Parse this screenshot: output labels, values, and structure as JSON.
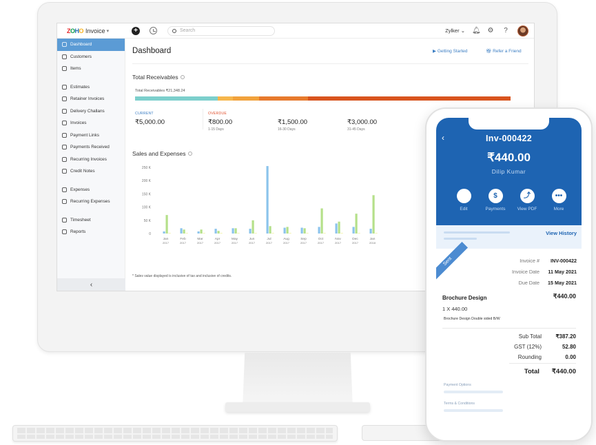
{
  "app": {
    "logo_letters": [
      "Z",
      "O",
      "H",
      "O"
    ],
    "name": "Invoice",
    "search_placeholder": "Search",
    "org": "Zylker",
    "org_chevron": "⌄"
  },
  "sidebar": {
    "items": [
      {
        "label": "Dashboard",
        "icon": "home-icon",
        "active": true
      },
      {
        "label": "Customers",
        "icon": "user-icon"
      },
      {
        "label": "Items",
        "icon": "box-icon"
      },
      {
        "label": "Estimates",
        "icon": "estimate-icon"
      },
      {
        "label": "Retainer Invoices",
        "icon": "retainer-icon"
      },
      {
        "label": "Delivery Challans",
        "icon": "truck-icon"
      },
      {
        "label": "Invoices",
        "icon": "invoice-icon"
      },
      {
        "label": "Payment Links",
        "icon": "link-icon"
      },
      {
        "label": "Payments Received",
        "icon": "payment-icon"
      },
      {
        "label": "Recurring Invoices",
        "icon": "recurring-icon"
      },
      {
        "label": "Credit Notes",
        "icon": "credit-note-icon"
      },
      {
        "label": "Expenses",
        "icon": "expense-icon"
      },
      {
        "label": "Recurring Expenses",
        "icon": "recurring-expense-icon"
      },
      {
        "label": "Timesheet",
        "icon": "timesheet-icon"
      },
      {
        "label": "Reports",
        "icon": "reports-icon"
      }
    ],
    "collapse_label": "‹"
  },
  "dashboard": {
    "title": "Dashboard",
    "getting_started": "Getting Started",
    "refer": "Refer a Friend",
    "receivables_title": "Total Receivables",
    "receivables_label": "Total Receivables ₹21,348.24",
    "receivables_bar": [
      {
        "fraction": 0.22,
        "color": "#7ccfcc"
      },
      {
        "fraction": 0.04,
        "color": "#f6b64c"
      },
      {
        "fraction": 0.07,
        "color": "#f1a23c"
      },
      {
        "fraction": 0.13,
        "color": "#e77a2d"
      },
      {
        "fraction": 0.54,
        "color": "#d8541e"
      }
    ],
    "current": {
      "label": "CURRENT",
      "value": "₹5,000.00"
    },
    "overdue_label": "OVERDUE",
    "buckets": [
      {
        "value": "₹800.00",
        "range": "1-15 Days"
      },
      {
        "value": "₹1,500.00",
        "range": "16-30 Days"
      },
      {
        "value": "₹3,000.00",
        "range": "31-45 Days"
      }
    ],
    "sales_title": "Sales and Expenses",
    "note": "* Sales value displayed is inclusive of tax and inclusive of credits."
  },
  "chart_data": {
    "type": "bar",
    "categories": [
      "Jan 2017",
      "Feb 2017",
      "Mar 2017",
      "Apr 2017",
      "May 2017",
      "Jun 2017",
      "Jul 2017",
      "Aug 2017",
      "Sep 2017",
      "Oct 2017",
      "Nov 2017",
      "Dec 2017",
      "Jan 2018"
    ],
    "yticks": [
      "250 K",
      "200 K",
      "150 K",
      "100 K",
      "50 K",
      "0"
    ],
    "ylim": [
      0,
      250000
    ],
    "series": [
      {
        "color": "#8cc4ec",
        "values": [
          8000,
          20000,
          8000,
          18000,
          20000,
          18000,
          255000,
          22000,
          22000,
          25000,
          38000,
          25000,
          18000
        ]
      },
      {
        "color": "#b5e08a",
        "values": [
          70000,
          15000,
          15000,
          10000,
          20000,
          50000,
          28000,
          25000,
          20000,
          95000,
          45000,
          75000,
          145000
        ]
      },
      {
        "color": "#f0f09a",
        "values": [
          2000,
          2000,
          2000,
          2000,
          2000,
          2000,
          2000,
          2000,
          2000,
          2000,
          2000,
          2000,
          2000
        ]
      }
    ]
  },
  "phone": {
    "invoice_number": "Inv-000422",
    "amount": "₹440.00",
    "customer": "Dilip Kumar",
    "actions": [
      {
        "label": "Edit",
        "icon": "edit-icon",
        "glyph": ""
      },
      {
        "label": "Payments",
        "icon": "dollar-icon",
        "glyph": "$"
      },
      {
        "label": "View PDF",
        "icon": "pdf-icon",
        "glyph": "⤴"
      },
      {
        "label": "More",
        "icon": "more-icon",
        "glyph": "•••"
      }
    ],
    "view_history": "View History",
    "status": "Sent",
    "invoice_no_label": "Invoice #",
    "invoice_no_value": "INV-000422",
    "date_label": "Invoice Date",
    "date_value": "11 May 2021",
    "due_label": "Due Date",
    "due_value": "15 May 2021",
    "item_name": "Brochure Design",
    "item_amount": "₹440.00",
    "item_qty": "1 X 440.00",
    "item_desc": "Brochure Design Double sided B/W",
    "subtotal_label": "Sub Total",
    "subtotal_value": "₹387.20",
    "gst_label": "GST (12%)",
    "gst_value": "52.80",
    "rounding_label": "Rounding",
    "rounding_value": "0.00",
    "total_label": "Total",
    "total_value": "₹440.00",
    "payment_options": "Payment Options",
    "terms": "Terms & Conditions"
  }
}
